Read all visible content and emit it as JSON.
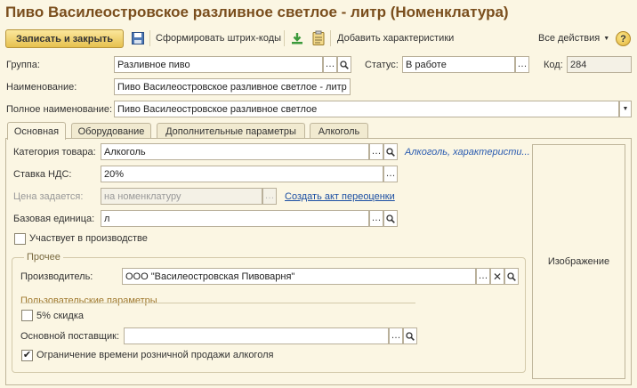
{
  "title": "Пиво Василеостровское разливное светлое - литр (Номенклатура)",
  "toolbar": {
    "save_close": "Записать и закрыть",
    "barcode": "Сформировать штрих-коды",
    "add_chars": "Добавить характеристики",
    "all_actions": "Все действия",
    "help": "?"
  },
  "header": {
    "group_label": "Группа:",
    "group_value": "Разливное пиво",
    "status_label": "Статус:",
    "status_value": "В работе",
    "code_label": "Код:",
    "code_value": "284",
    "name_label": "Наименование:",
    "name_value": "Пиво Василеостровское разливное светлое - литр",
    "fullname_label": "Полное наименование:",
    "fullname_value": "Пиво Василеостровское разливное светлое"
  },
  "tabs": [
    "Основная",
    "Оборудование",
    "Дополнительные параметры",
    "Алкоголь"
  ],
  "main": {
    "category_label": "Категория товара:",
    "category_value": "Алкоголь",
    "category_link": "Алкоголь, характеристи...",
    "vat_label": "Ставка НДС:",
    "vat_value": "20%",
    "price_label": "Цена задается:",
    "price_value": "на номенклатуру",
    "price_link": "Создать акт переоценки",
    "unit_label": "Базовая единица:",
    "unit_value": "л",
    "production_label": "Участвует в производстве",
    "production_checked": false,
    "other_title": "Прочее",
    "producer_label": "Производитель:",
    "producer_value": "ООО \"Василеостровская Пивоварня\"",
    "user_params_title": "Пользовательские параметры",
    "discount_label": "5% скидка",
    "discount_checked": false,
    "supplier_label": "Основной поставщик:",
    "supplier_value": "",
    "retail_limit_label": "Ограничение времени розничной продажи алкоголя",
    "retail_limit_checked": true,
    "image_label": "Изображение"
  },
  "colors": {
    "background": "#fbf6e3",
    "title": "#7a4e1d",
    "primary_button": "#e6c14f",
    "link": "#1c4fa3"
  }
}
